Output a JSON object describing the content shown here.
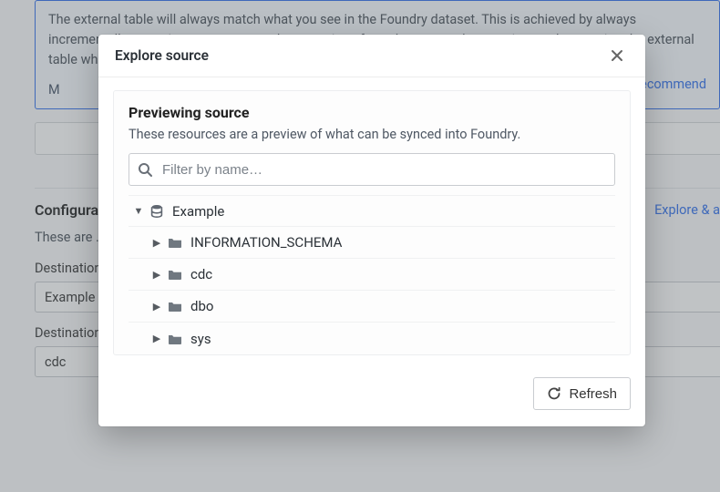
{
  "background": {
    "card_text": "The external table will always match what you see in the Foundry dataset. This is achieved by always incrementally exporting any unexported transactions from the current dataset view, and truncating the external table when the Foundry dataset is resubmitted. This mechanism supports update and d",
    "more": "M",
    "recommend_link": "Recommend",
    "config_title": "Configura",
    "explore_link": "Explore & au",
    "config_body": "These are …tten. Your in must prec… JDBC expo refer to ou",
    "dest_label": "Destination",
    "dest_value": "Example",
    "schema_label": "Destination schema",
    "schema_value": "cdc"
  },
  "modal": {
    "title": "Explore source",
    "preview_title": "Previewing source",
    "preview_desc": "These resources are a preview of what can be synced into Foundry.",
    "filter_placeholder": "Filter by name…",
    "refresh_label": "Refresh"
  },
  "tree": {
    "root": "Example",
    "children": [
      {
        "name": "INFORMATION_SCHEMA"
      },
      {
        "name": "cdc"
      },
      {
        "name": "dbo"
      },
      {
        "name": "sys"
      }
    ]
  }
}
